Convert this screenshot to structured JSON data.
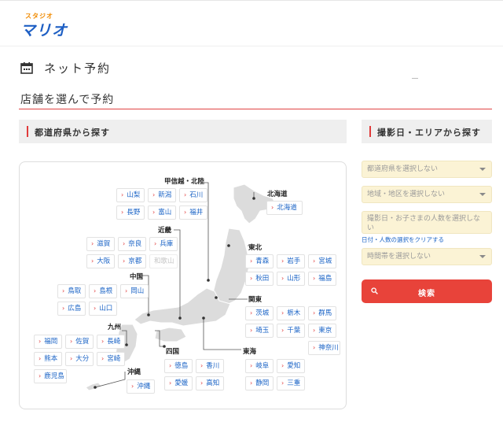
{
  "header": {
    "logo_sub": "スタジオ",
    "logo_main": "マリオ"
  },
  "page": {
    "title": "ネット予約",
    "section_title": "店舗を選んで予約"
  },
  "left_panel": {
    "heading": "都道府県から探す"
  },
  "right_panel": {
    "heading": "撮影日・エリアから探す",
    "prefecture_select": "都道府県を選択しない",
    "area_select": "地域・地区を選択しない",
    "date_select": "撮影日・お子さまの人数を選択しない",
    "clear_link": "日付・人数の選択をクリアする",
    "time_select": "時間帯を選択しない",
    "search_label": "検索"
  },
  "regions": {
    "koshinetsu": "甲信越・北陸",
    "hokkaido": "北海道",
    "kinki": "近畿",
    "tohoku": "東北",
    "chugoku": "中国",
    "kanto": "関東",
    "kyushu": "九州",
    "shikoku": "四国",
    "tokai": "東海",
    "okinawa": "沖縄"
  },
  "prefectures": {
    "yamanashi": "山梨",
    "niigata": "新潟",
    "ishikawa": "石川",
    "nagano": "長野",
    "toyama": "富山",
    "fukui": "福井",
    "hokkaido": "北海道",
    "shiga": "滋賀",
    "nara": "奈良",
    "hyogo": "兵庫",
    "osaka": "大阪",
    "kyoto": "京都",
    "wakayama": "和歌山",
    "aomori": "青森",
    "iwate": "岩手",
    "miyagi": "宮城",
    "akita": "秋田",
    "yamagata": "山形",
    "fukushima": "福島",
    "tottori": "鳥取",
    "shimane": "島根",
    "okayama": "岡山",
    "hiroshima": "広島",
    "yamaguchi": "山口",
    "ibaraki": "茨城",
    "tochigi": "栃木",
    "gunma": "群馬",
    "saitama": "埼玉",
    "chiba": "千葉",
    "tokyo": "東京",
    "kanagawa": "神奈川",
    "fukuoka": "福岡",
    "saga": "佐賀",
    "nagasaki": "長崎",
    "kumamoto": "熊本",
    "oita": "大分",
    "miyazaki": "宮崎",
    "kagoshima": "鹿児島",
    "tokushima": "徳島",
    "kagawa": "香川",
    "ehime": "愛媛",
    "kochi": "高知",
    "gifu": "岐阜",
    "aichi": "愛知",
    "shizuoka": "静岡",
    "mie": "三重",
    "okinawa": "沖縄"
  },
  "colors": {
    "accent_red": "#e03a3a",
    "link_blue": "#1a63c6",
    "select_bg": "#fbf3d5",
    "search_bg": "#e8433a"
  }
}
